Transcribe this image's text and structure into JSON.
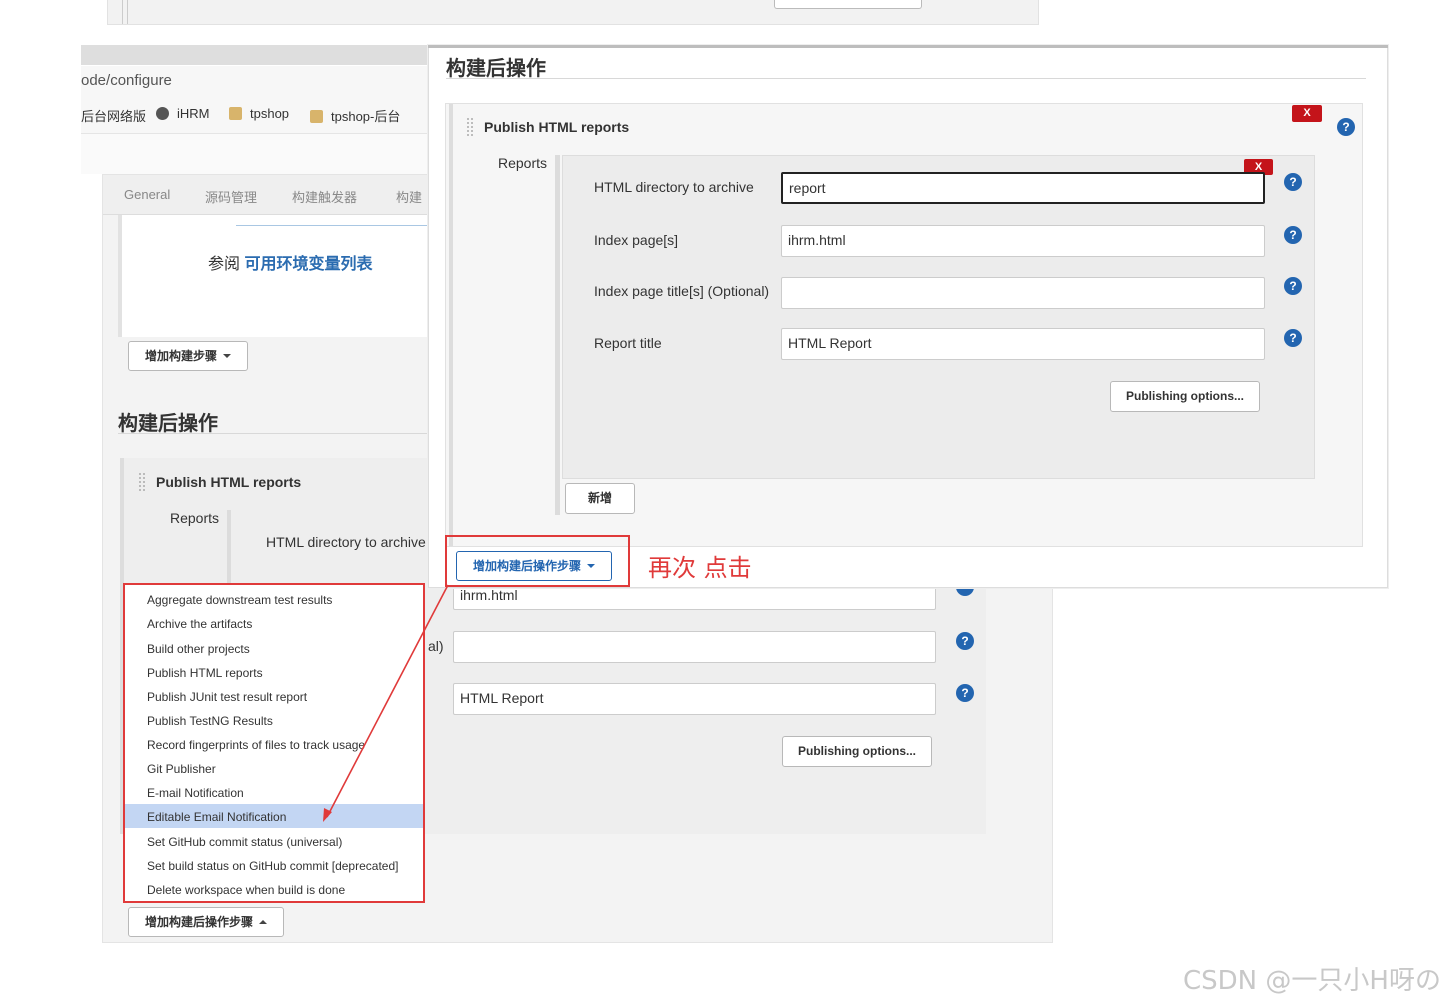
{
  "browser": {
    "url_fragment": "ode/configure",
    "bookmarks": [
      "后台网络版",
      "iHRM",
      "tpshop",
      "tpshop-后台"
    ]
  },
  "back": {
    "tabs": [
      "General",
      "源码管理",
      "构建触发器",
      "构建"
    ],
    "reference_prefix": "参阅",
    "reference_link": "可用环境变量列表",
    "add_build_step": "增加构建步骤",
    "post_build_heading": "构建后操作",
    "publish_title": "Publish HTML reports",
    "reports_label": "Reports",
    "html_dir_label": "HTML directory to archive",
    "index_value": "ihrm.html",
    "optional_fragment": "al)",
    "report_title_value": "HTML Report",
    "publishing_options": "Publishing options...",
    "add_post_build_step": "增加构建后操作步骤",
    "menu_items": [
      "Aggregate downstream test results",
      "Archive the artifacts",
      "Build other projects",
      "Publish HTML reports",
      "Publish JUnit test result report",
      "Publish TestNG Results",
      "Record fingerprints of files to track usage",
      "Git Publisher",
      "E-mail Notification",
      "Editable Email Notification",
      "Set GitHub commit status (universal)",
      "Set build status on GitHub commit [deprecated]",
      "Delete workspace when build is done"
    ],
    "menu_highlighted": "Editable Email Notification"
  },
  "front": {
    "heading": "构建后操作",
    "publish_title": "Publish HTML reports",
    "delete_label": "X",
    "reports_label": "Reports",
    "fields": [
      {
        "label": "HTML directory to archive",
        "value": "report"
      },
      {
        "label": "Index page[s]",
        "value": "ihrm.html"
      },
      {
        "label": "Index page title[s] (Optional)",
        "value": ""
      },
      {
        "label": "Report title",
        "value": "HTML Report"
      }
    ],
    "publishing_options": "Publishing options...",
    "add_button": "新增",
    "add_post_build_step": "增加构建后操作步骤",
    "help_glyph": "?"
  },
  "annotation": "再次 点击",
  "watermark": "CSDN @一只小H呀の",
  "colors": {
    "annotation_red": "#e03a3a",
    "link_blue": "#2b6cb0",
    "help_blue": "#2365b0",
    "delete_red": "#c4141a",
    "menu_highlight": "#c3d6f3"
  }
}
